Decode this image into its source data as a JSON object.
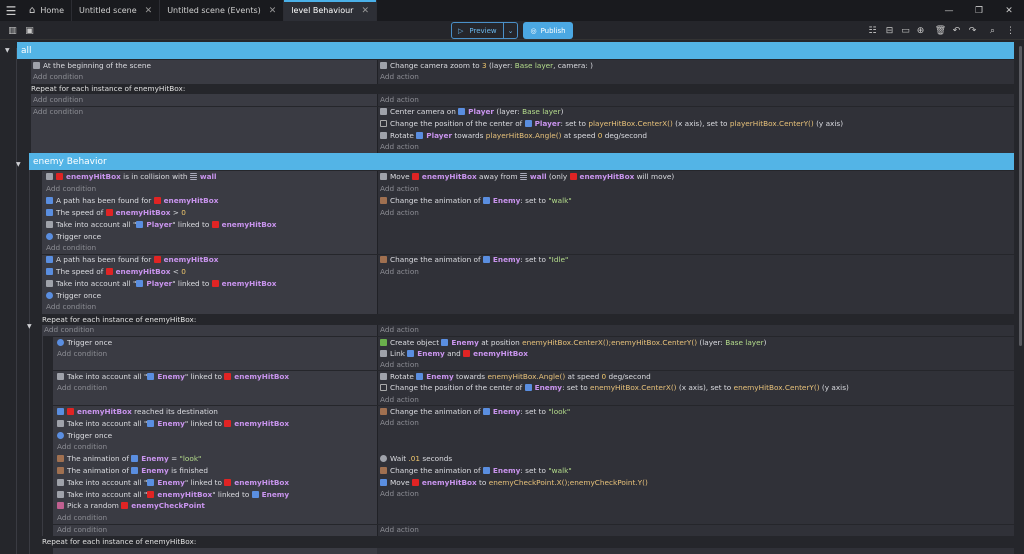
{
  "tabs": {
    "home": "Home",
    "scene": "Untitled scene",
    "events": "Untitled scene (Events)",
    "behaviour": "level Behaviour"
  },
  "toolbar": {
    "preview": "Preview",
    "publish": "Publish"
  },
  "groups": {
    "all": "all",
    "enemy": "enemy Behavior"
  },
  "common": {
    "add_condition": "Add condition",
    "add_action": "Add action",
    "repeat": "Repeat for each instance of enemyHitBox:"
  },
  "e1": {
    "c1": "At the beginning of the scene",
    "a1a": "Change camera zoom to ",
    "a1b": "3",
    "a1c": " (layer: ",
    "a1d": "Base layer",
    "a1e": ", camera: )"
  },
  "e2": {
    "a1": "Center camera on ",
    "a1o": "Player",
    "a1b": " (layer: ",
    "a1c": "Base layer",
    "a1d": ")",
    "a2": "Change the position of the center of ",
    "a2o": "Player",
    "a2b": ": set to ",
    "a2c": "playerHitBox.CenterX()",
    "a2d": " (x axis), ",
    "a2e": "set to ",
    "a2f": "playerHitBox.CenterY()",
    "a2g": " (y axis)",
    "a3": "Rotate ",
    "a3o": "Player",
    "a3b": " towards ",
    "a3c": "playerHitBox.Angle()",
    "a3d": " at speed ",
    "a3e": "0",
    "a3f": " deg/second"
  },
  "e3": {
    "c1o": "enemyHitBox",
    "c1b": " is in collision with ",
    "c1c": "wall",
    "a1": "Move ",
    "a1o": "enemyHitBox",
    "a1b": " away from ",
    "a1c": "wall",
    "a1d": " (only ",
    "a1e": "enemyHitBox",
    "a1f": " will move)"
  },
  "e4": {
    "c1": "A path has been found for ",
    "c1o": "enemyHitBox",
    "c2": "The speed of ",
    "c2o": "enemyHitBox",
    "c2b": " > ",
    "c2c": "0",
    "c3": "Take into account all \"",
    "c3o": "Player",
    "c3b": "\" linked to ",
    "c3c": "enemyHitBox",
    "c4": "Trigger once",
    "a1": "Change the animation of ",
    "a1o": "Enemy",
    "a1b": ": set to ",
    "a1c": "\"walk\""
  },
  "e5": {
    "c1": "A path has been found for ",
    "c1o": "enemyHitBox",
    "c2": "The speed of ",
    "c2o": "enemyHitBox",
    "c2b": " < ",
    "c2c": "0",
    "c3": "Take into account all \"",
    "c3o": "Player",
    "c3b": "\" linked to ",
    "c3c": "enemyHitBox",
    "c4": "Trigger once",
    "a1": "Change the animation of ",
    "a1o": "Enemy",
    "a1b": ": set to ",
    "a1c": "\"Idle\""
  },
  "e6": {
    "c1": "Trigger once",
    "a1": "Create object ",
    "a1o": "Enemy",
    "a1b": " at position ",
    "a1c": "enemyHitBox.CenterX();enemyHitBox.CenterY()",
    "a1d": " (layer: ",
    "a1e": "Base layer",
    "a1f": ")",
    "a2": "Link ",
    "a2o": "Enemy",
    "a2b": " and ",
    "a2c": "enemyHitBox"
  },
  "e7": {
    "c1": "Take into account all \"",
    "c1o": "Enemy",
    "c1b": "\" linked to ",
    "c1c": "enemyHitBox",
    "a1": "Rotate ",
    "a1o": "Enemy",
    "a1b": " towards ",
    "a1c": "enemyHitBox.Angle()",
    "a1d": " at speed ",
    "a1e": "0",
    "a1f": " deg/second",
    "a2": "Change the position of the center of ",
    "a2o": "Enemy",
    "a2b": ": set to ",
    "a2c": "enemyHitBox.CenterX()",
    "a2d": " (x axis), ",
    "a2e": "set to ",
    "a2f": "enemyHitBox.CenterY()",
    "a2g": " (y axis)"
  },
  "e8": {
    "c1o": "enemyHitBox",
    "c1b": " reached its destination",
    "c2": "Take into account all \"",
    "c2o": "Enemy",
    "c2b": "\" linked to ",
    "c2c": "enemyHitBox",
    "c3": "Trigger once",
    "a1": "Change the animation of ",
    "a1o": "Enemy",
    "a1b": ": set to ",
    "a1c": "\"look\""
  },
  "e9": {
    "c1": "The animation of ",
    "c1o": "Enemy",
    "c1b": " = ",
    "c1c": "\"look\"",
    "c2": "The animation of ",
    "c2o": "Enemy",
    "c2b": " is finished",
    "c3": "Take into account all \"",
    "c3o": "Enemy",
    "c3b": "\" linked to ",
    "c3c": "enemyHitBox",
    "c4": "Take into account all \"",
    "c4o": "enemyHitBox",
    "c4b": "\" linked to ",
    "c4c": "Enemy",
    "c5": "Pick a random ",
    "c5o": "enemyCheckPoint",
    "a1": "Wait ",
    "a1b": ".01",
    "a1c": " seconds",
    "a2": "Change the animation of ",
    "a2o": "Enemy",
    "a2b": ": set to ",
    "a2c": "\"walk\"",
    "a3": "Move ",
    "a3o": "enemyHitBox",
    "a3b": " to ",
    "a3c": "enemyCheckPoint.X();enemyCheckPoint.Y()"
  }
}
